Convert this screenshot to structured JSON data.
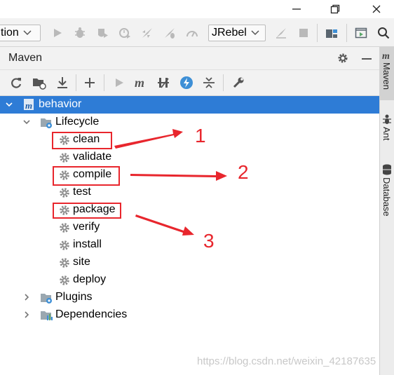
{
  "toolbar": {
    "run_config_text": "tion",
    "jrebel_label": "JRebel"
  },
  "maven_panel": {
    "title": "Maven"
  },
  "side_tabs": [
    {
      "label": "Maven",
      "icon": "maven-m-icon"
    },
    {
      "label": "Ant",
      "icon": "ant-icon"
    },
    {
      "label": "Database",
      "icon": "database-icon"
    }
  ],
  "tree": {
    "root": {
      "label": "behavior",
      "expanded": true,
      "selected": true
    },
    "lifecycle": {
      "label": "Lifecycle",
      "expanded": true
    },
    "phases": [
      "clean",
      "validate",
      "compile",
      "test",
      "package",
      "verify",
      "install",
      "site",
      "deploy"
    ],
    "plugins": {
      "label": "Plugins",
      "expanded": false
    },
    "dependencies": {
      "label": "Dependencies",
      "expanded": false
    }
  },
  "annotations": {
    "labels": [
      "1",
      "2",
      "3"
    ],
    "color": "#e8262d"
  },
  "watermark": "https://blog.csdn.net/weixin_42187635",
  "colors": {
    "selection": "#2e7cd6",
    "gear": "#8c8c8c",
    "lightning": "#3d8fd6"
  }
}
